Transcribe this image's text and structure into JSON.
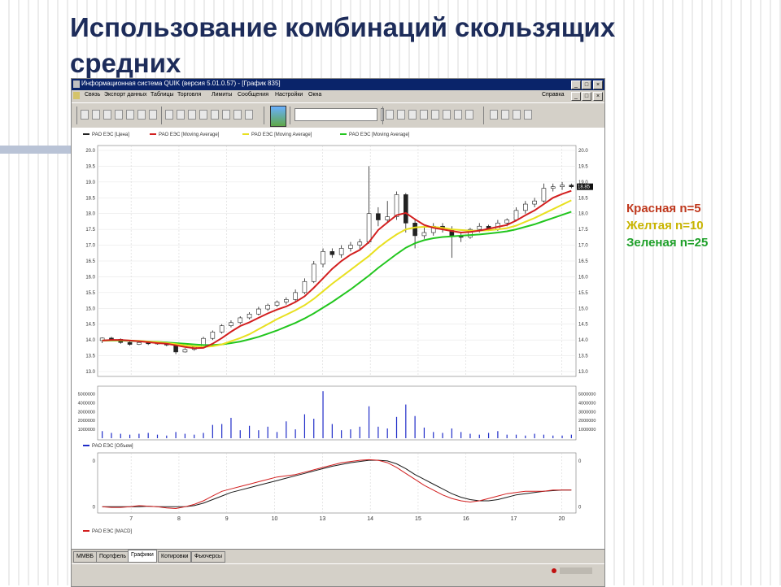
{
  "slide": {
    "title": "Использование комбинаций скользящих средних",
    "legend": [
      {
        "label": "Красная n=5",
        "color": "#c0391e"
      },
      {
        "label": "Желтая n=10",
        "color": "#c8b400"
      },
      {
        "label": "Зеленая n=25",
        "color": "#1fa02a"
      }
    ]
  },
  "app": {
    "title": "Информационная система QUIK (версия 5.01.0.57) - [График 835]",
    "menu": [
      "Связь",
      "Экспорт данных",
      "Таблицы",
      "Торговля",
      "Лимиты",
      "Сообщения",
      "Настройки",
      "Окна"
    ],
    "menu_right": "Справка",
    "tabs": [
      "ММВБ",
      "Портфель",
      "Графики",
      "Котировки",
      "Фьючерсы"
    ],
    "active_tab": "Графики"
  },
  "colors": {
    "price": "#222222",
    "ma5": "#d21f1f",
    "ma10": "#e8e020",
    "ma25": "#22c61e",
    "macd": "#d21f1f",
    "signal": "#1a1a1a",
    "volume": "#1f2cc8"
  },
  "chart_data": {
    "type": "line",
    "price_panel": {
      "series_legend": [
        "РАО ЕЭС [Цена]",
        "РАО ЕЭС [Moving Average]",
        "РАО ЕЭС [Moving Average]",
        "РАО ЕЭС [Moving Average]"
      ],
      "ylim": [
        13.0,
        20.0
      ],
      "left_ticks": [
        "20.0",
        "19.5",
        "19.0",
        "18.5",
        "18.0",
        "17.5",
        "17.0",
        "16.5",
        "16.0",
        "15.5",
        "15.0",
        "14.5",
        "14.0",
        "13.5",
        "13.0"
      ],
      "right_ticks": [
        "20.0",
        "19.5",
        "19.0",
        "18.5",
        "18.0",
        "17.5",
        "17.0",
        "16.5",
        "16.0",
        "15.5",
        "15.0",
        "14.5",
        "14.0",
        "13.5",
        "13.0"
      ],
      "last_value": "18.85",
      "candles": [
        [
          13.98,
          14.06,
          13.9,
          14.08
        ],
        [
          14.06,
          14.02,
          13.98,
          14.1
        ],
        [
          14.02,
          13.92,
          13.88,
          14.05
        ],
        [
          13.92,
          13.86,
          13.82,
          13.96
        ],
        [
          13.86,
          13.92,
          13.84,
          13.95
        ],
        [
          13.92,
          13.88,
          13.84,
          13.94
        ],
        [
          13.88,
          13.9,
          13.85,
          13.93
        ],
        [
          13.9,
          13.84,
          13.8,
          13.92
        ],
        [
          13.84,
          13.62,
          13.55,
          13.86
        ],
        [
          13.62,
          13.7,
          13.6,
          13.74
        ],
        [
          13.7,
          13.78,
          13.66,
          13.8
        ],
        [
          13.78,
          14.05,
          13.75,
          14.1
        ],
        [
          14.05,
          14.25,
          14.0,
          14.3
        ],
        [
          14.25,
          14.45,
          14.2,
          14.5
        ],
        [
          14.45,
          14.55,
          14.4,
          14.62
        ],
        [
          14.55,
          14.7,
          14.5,
          14.75
        ],
        [
          14.7,
          14.82,
          14.65,
          14.88
        ],
        [
          14.82,
          14.98,
          14.78,
          15.05
        ],
        [
          14.98,
          15.1,
          14.92,
          15.15
        ],
        [
          15.1,
          15.2,
          15.05,
          15.25
        ],
        [
          15.2,
          15.28,
          15.12,
          15.35
        ],
        [
          15.28,
          15.5,
          15.2,
          15.6
        ],
        [
          15.5,
          15.85,
          15.45,
          15.95
        ],
        [
          15.85,
          16.4,
          15.8,
          16.5
        ],
        [
          16.4,
          16.8,
          16.3,
          16.9
        ],
        [
          16.8,
          16.7,
          16.6,
          16.9
        ],
        [
          16.7,
          16.9,
          16.6,
          17.0
        ],
        [
          16.9,
          17.0,
          16.8,
          17.1
        ],
        [
          17.0,
          17.1,
          16.85,
          17.2
        ],
        [
          17.1,
          18.0,
          17.05,
          19.5
        ],
        [
          18.0,
          17.8,
          17.6,
          18.2
        ],
        [
          17.8,
          17.9,
          17.7,
          18.4
        ],
        [
          17.9,
          18.6,
          17.8,
          18.7
        ],
        [
          18.6,
          17.7,
          17.4,
          18.65
        ],
        [
          17.7,
          17.3,
          16.9,
          17.8
        ],
        [
          17.3,
          17.4,
          17.2,
          17.6
        ],
        [
          17.4,
          17.6,
          17.3,
          17.7
        ],
        [
          17.6,
          17.5,
          17.4,
          17.7
        ],
        [
          17.5,
          17.3,
          16.6,
          17.6
        ],
        [
          17.3,
          17.25,
          17.1,
          17.4
        ],
        [
          17.25,
          17.5,
          17.2,
          17.55
        ],
        [
          17.5,
          17.6,
          17.4,
          17.7
        ],
        [
          17.6,
          17.5,
          17.45,
          17.65
        ],
        [
          17.5,
          17.7,
          17.45,
          17.8
        ],
        [
          17.7,
          17.8,
          17.6,
          17.85
        ],
        [
          17.8,
          18.1,
          17.75,
          18.2
        ],
        [
          18.1,
          18.3,
          18.0,
          18.4
        ],
        [
          18.3,
          18.4,
          18.2,
          18.5
        ],
        [
          18.4,
          18.8,
          18.35,
          18.95
        ],
        [
          18.8,
          18.85,
          18.7,
          18.95
        ],
        [
          18.85,
          18.9,
          18.75,
          19.0
        ],
        [
          18.9,
          18.85,
          18.8,
          18.95
        ]
      ],
      "ma5": [
        13.98,
        14.0,
        14.0,
        13.98,
        13.96,
        13.93,
        13.9,
        13.88,
        13.83,
        13.78,
        13.74,
        13.75,
        13.88,
        14.06,
        14.26,
        14.44,
        14.56,
        14.7,
        14.84,
        14.96,
        15.06,
        15.2,
        15.38,
        15.65,
        15.95,
        16.25,
        16.5,
        16.7,
        16.85,
        17.1,
        17.48,
        17.72,
        17.95,
        18.02,
        17.82,
        17.64,
        17.55,
        17.5,
        17.45,
        17.4,
        17.42,
        17.46,
        17.52,
        17.58,
        17.64,
        17.78,
        17.95,
        18.1,
        18.3,
        18.5,
        18.62,
        18.72
      ],
      "ma10": [
        13.98,
        13.99,
        13.99,
        13.98,
        13.97,
        13.95,
        13.93,
        13.9,
        13.87,
        13.83,
        13.8,
        13.78,
        13.8,
        13.86,
        13.96,
        14.06,
        14.18,
        14.34,
        14.5,
        14.66,
        14.8,
        14.94,
        15.1,
        15.3,
        15.54,
        15.78,
        16.0,
        16.22,
        16.44,
        16.66,
        16.92,
        17.14,
        17.34,
        17.5,
        17.56,
        17.58,
        17.58,
        17.55,
        17.5,
        17.48,
        17.46,
        17.46,
        17.47,
        17.5,
        17.54,
        17.62,
        17.74,
        17.86,
        18.0,
        18.14,
        18.28,
        18.42
      ],
      "ma25": [
        13.98,
        13.98,
        13.98,
        13.97,
        13.96,
        13.95,
        13.94,
        13.92,
        13.9,
        13.88,
        13.86,
        13.84,
        13.84,
        13.86,
        13.9,
        13.95,
        14.02,
        14.1,
        14.2,
        14.3,
        14.42,
        14.54,
        14.68,
        14.84,
        15.02,
        15.2,
        15.4,
        15.6,
        15.82,
        16.04,
        16.28,
        16.5,
        16.72,
        16.92,
        17.06,
        17.16,
        17.22,
        17.26,
        17.28,
        17.3,
        17.32,
        17.34,
        17.37,
        17.4,
        17.44,
        17.5,
        17.58,
        17.66,
        17.76,
        17.86,
        17.96,
        18.06
      ]
    },
    "volume_panel": {
      "series_legend": "РАО ЕЭС [Объем]",
      "left_ticks": [
        "5000000",
        "4000000",
        "3000000",
        "2000000",
        "1000000"
      ],
      "right_ticks": [
        "5000000",
        "4000000",
        "3000000",
        "2000000",
        "1000000"
      ],
      "ylim": [
        0,
        5500000
      ],
      "values": [
        800000,
        600000,
        500000,
        400000,
        500000,
        600000,
        400000,
        300000,
        700000,
        500000,
        400000,
        600000,
        1500000,
        1600000,
        2300000,
        900000,
        1400000,
        900000,
        1300000,
        700000,
        1900000,
        1000000,
        2700000,
        2200000,
        5300000,
        1600000,
        900000,
        1000000,
        1300000,
        3600000,
        1300000,
        1100000,
        2400000,
        3800000,
        2500000,
        1200000,
        700000,
        600000,
        1100000,
        700000,
        500000,
        400000,
        600000,
        800000,
        400000,
        400000,
        300000,
        500000,
        400000,
        300000,
        300000,
        400000
      ]
    },
    "macd_panel": {
      "series_legend": "РАО ЕЭС [MACD]",
      "left_ticks": [
        "0",
        "0"
      ],
      "right_ticks": [
        "0",
        "0"
      ],
      "ylim": [
        -0.05,
        0.85
      ],
      "macd": [
        0.0,
        -0.01,
        -0.01,
        0.0,
        0.02,
        0.01,
        0.0,
        -0.02,
        -0.03,
        0.0,
        0.04,
        0.1,
        0.18,
        0.26,
        0.3,
        0.34,
        0.38,
        0.42,
        0.46,
        0.5,
        0.52,
        0.54,
        0.58,
        0.62,
        0.66,
        0.7,
        0.74,
        0.76,
        0.78,
        0.79,
        0.78,
        0.74,
        0.66,
        0.56,
        0.46,
        0.36,
        0.28,
        0.2,
        0.14,
        0.1,
        0.08,
        0.1,
        0.14,
        0.18,
        0.22,
        0.24,
        0.26,
        0.26,
        0.26,
        0.28,
        0.28,
        0.28
      ],
      "signal": [
        0.0,
        0.0,
        0.0,
        0.0,
        0.0,
        0.01,
        0.0,
        0.0,
        0.0,
        0.0,
        0.02,
        0.06,
        0.12,
        0.18,
        0.24,
        0.28,
        0.32,
        0.36,
        0.4,
        0.44,
        0.48,
        0.52,
        0.56,
        0.6,
        0.64,
        0.68,
        0.71,
        0.74,
        0.76,
        0.78,
        0.78,
        0.77,
        0.72,
        0.64,
        0.54,
        0.46,
        0.38,
        0.3,
        0.22,
        0.16,
        0.12,
        0.1,
        0.1,
        0.12,
        0.16,
        0.2,
        0.22,
        0.24,
        0.26,
        0.27,
        0.28,
        0.28
      ]
    },
    "x_labels": [
      "7",
      "8",
      "9",
      "10",
      "13",
      "14",
      "15",
      "16",
      "17",
      "20"
    ]
  }
}
